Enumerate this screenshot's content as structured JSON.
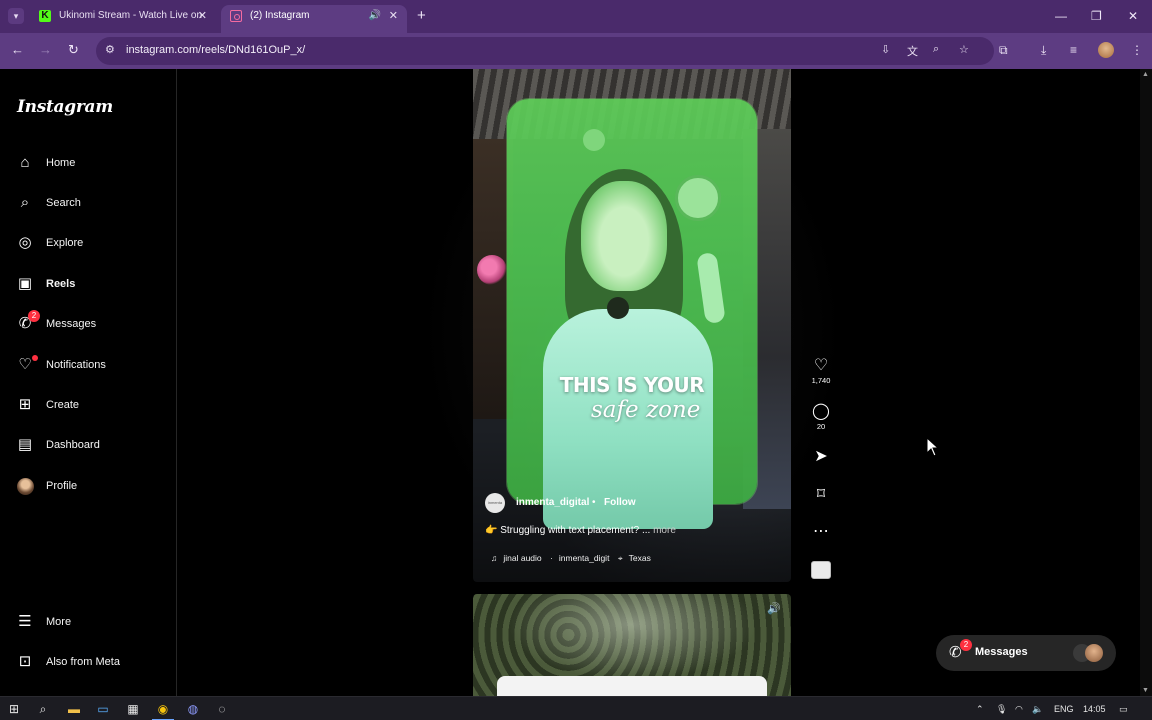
{
  "browser": {
    "tabs": [
      {
        "title": "Ukinomi Stream - Watch Live on",
        "favicon": "kick-logo-icon"
      },
      {
        "title": "(2) Instagram",
        "favicon": "instagram-icon",
        "active": true
      }
    ],
    "url": "instagram.com/reels/DNd161OuP_x/"
  },
  "instagram": {
    "logo": "Instagram",
    "nav": [
      {
        "label": "Home",
        "icon": "home-icon"
      },
      {
        "label": "Search",
        "icon": "search-icon"
      },
      {
        "label": "Explore",
        "icon": "compass-icon"
      },
      {
        "label": "Reels",
        "icon": "reels-icon",
        "active": true
      },
      {
        "label": "Messages",
        "icon": "messenger-icon",
        "badge": "2"
      },
      {
        "label": "Notifications",
        "icon": "heart-icon",
        "dot": true
      },
      {
        "label": "Create",
        "icon": "plus-square-icon"
      },
      {
        "label": "Dashboard",
        "icon": "dashboard-icon"
      },
      {
        "label": "Profile",
        "icon": "avatar"
      }
    ],
    "bottom_nav": [
      {
        "label": "More",
        "icon": "menu-icon"
      },
      {
        "label": "Also from Meta",
        "icon": "meta-apps-icon"
      }
    ]
  },
  "reel": {
    "overlay_line1": "THIS IS YOUR",
    "overlay_line2": "safe zone",
    "username": "inmenta_digital",
    "separator": "•",
    "follow_label": "Follow",
    "caption_emoji": "👉",
    "caption": "Struggling with text placement? ...",
    "caption_more": "more",
    "audio": "jinal audio",
    "audio_author": "inmenta_digit",
    "location": "Texas",
    "likes": "1,740",
    "comments": "20"
  },
  "messages_pill": {
    "label": "Messages",
    "badge": "2"
  },
  "taskbar": {
    "lang": "ENG",
    "time": "14:05"
  },
  "colors": {
    "tabbar": "#4a2a6b",
    "toolbar": "#5d3c82",
    "badge": "#ff3040",
    "overlay_green": "#4fc452"
  }
}
